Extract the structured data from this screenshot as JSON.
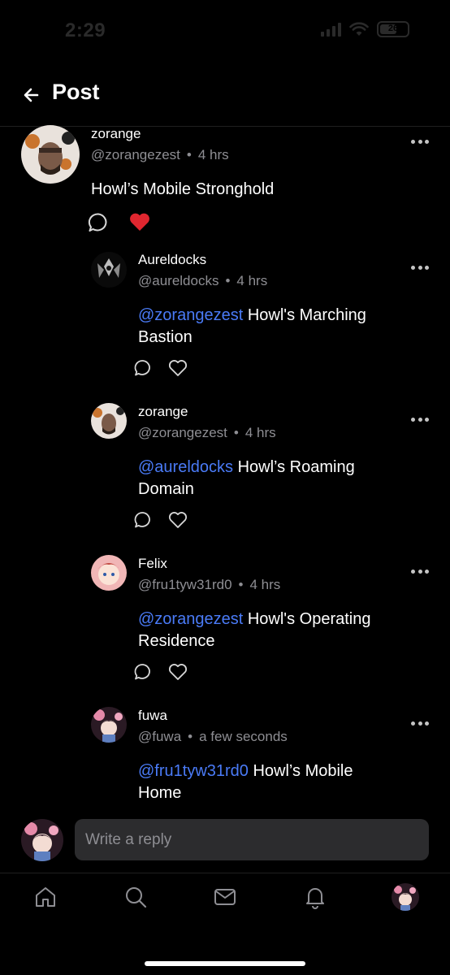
{
  "status": {
    "time": "2:29",
    "battery": "26"
  },
  "header": {
    "title": "Post"
  },
  "main_post": {
    "name": "zorange",
    "handle": "@zorangezest",
    "time": "4 hrs",
    "text": "Howl’s Mobile Stronghold",
    "liked": true
  },
  "replies": [
    {
      "name": "Aureldocks",
      "handle": "@aureldocks",
      "time": "4 hrs",
      "mention": "@zorangezest",
      "text_line1": " Howl's Marching",
      "text_line2": "Bastion"
    },
    {
      "name": "zorange",
      "handle": "@zorangezest",
      "time": "4 hrs",
      "mention": "@aureldocks",
      "text_line1": " Howl’s Roaming",
      "text_line2": "Domain"
    },
    {
      "name": "Felix",
      "handle": "@fru1tyw31rd0",
      "time": "4 hrs",
      "mention": "@zorangezest",
      "text_line1": " Howl's Operating",
      "text_line2": "Residence"
    },
    {
      "name": "fuwa",
      "handle": "@fuwa",
      "time": "a few seconds",
      "mention": "@fru1tyw31rd0",
      "text_line1": " Howl’s Mobile",
      "text_line2": "Home"
    }
  ],
  "reply_input": {
    "placeholder": "Write a reply"
  },
  "colors": {
    "mention": "#4a7bf7",
    "like": "#e0262f",
    "input_bg": "#2c2c2e"
  },
  "tabs": [
    "home-icon",
    "search-icon",
    "mail-icon",
    "bell-icon",
    "profile-avatar"
  ]
}
